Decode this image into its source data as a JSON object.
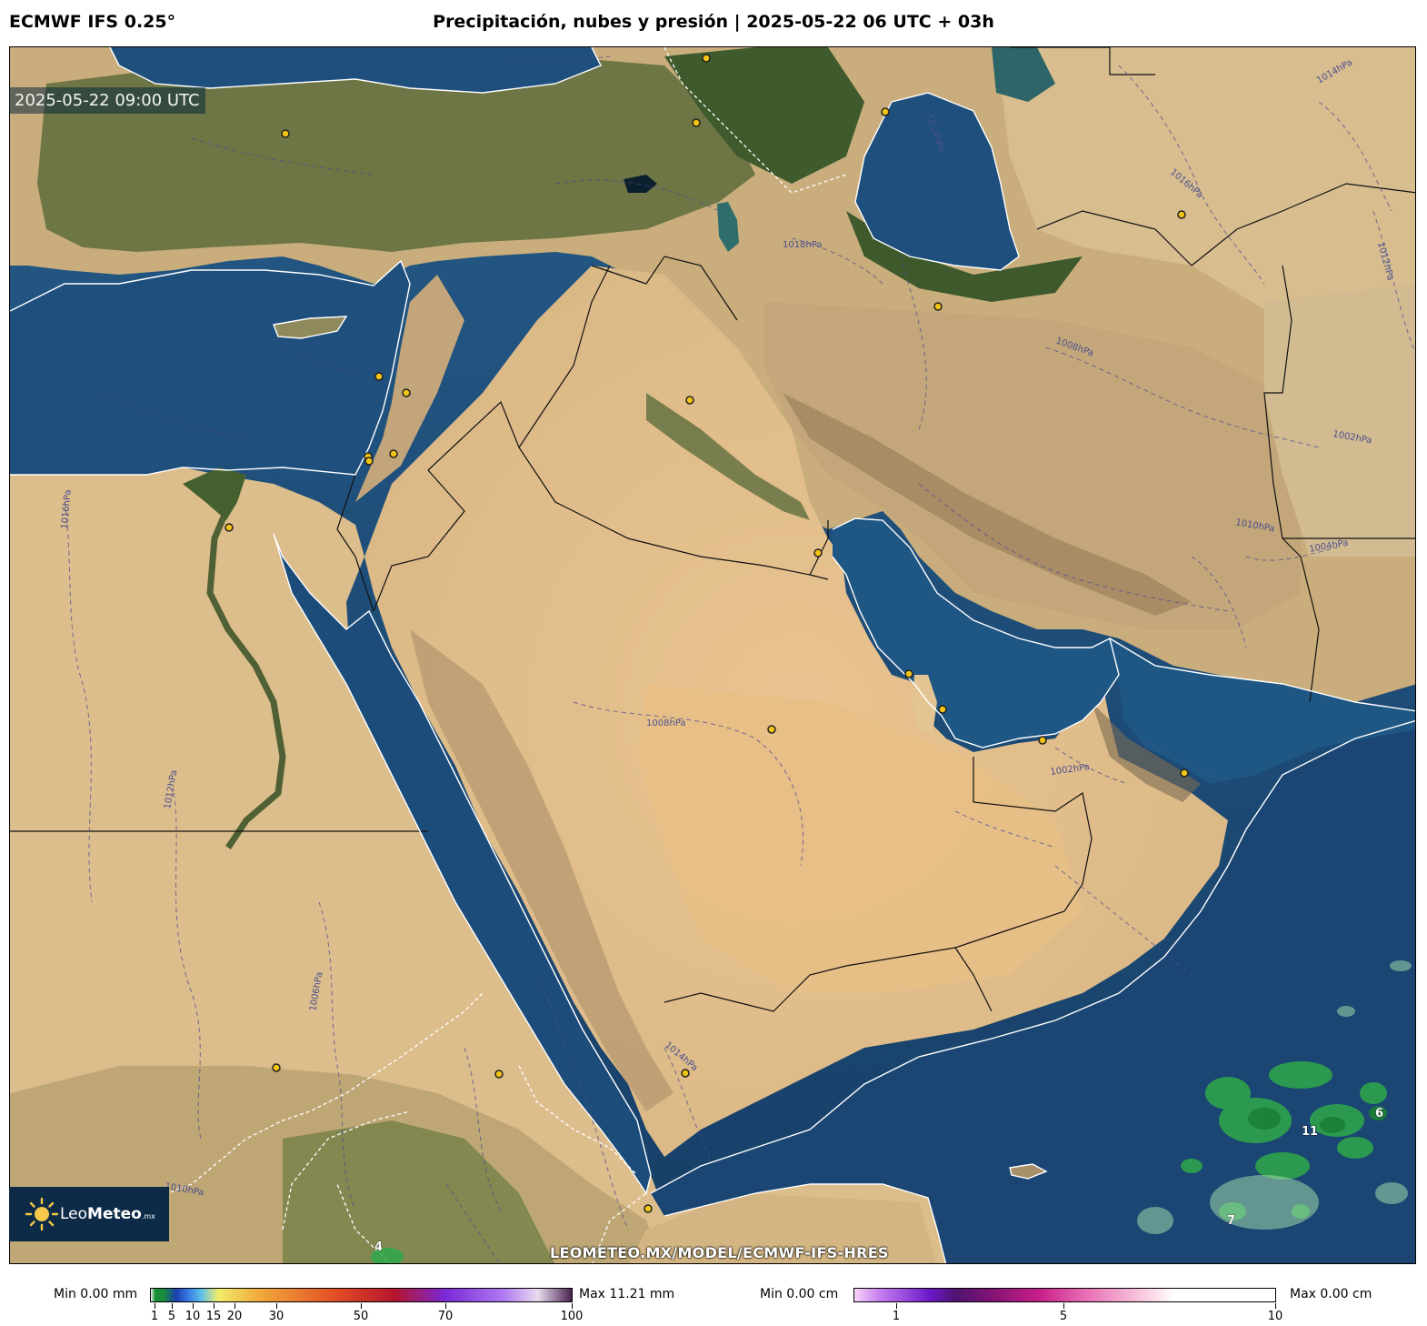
{
  "header": {
    "model": "ECMWF IFS 0.25°",
    "title": "Precipitación, nubes y presión | 2025-05-22 06 UTC + 03h"
  },
  "map": {
    "valid_time": "2025-05-22 09:00 UTC",
    "url": "LEOMETEO.MX/MODEL/ECMWF-IFS-HRES",
    "logo": {
      "brand_light": "Leo",
      "brand_bold": "Meteo",
      "suffix": ".mx"
    },
    "isobar_labels": [
      "1008hPa",
      "1012hPa",
      "1014hPa",
      "1016hPa",
      "1016hPa",
      "1018hPa",
      "1014hPa",
      "1012hPa",
      "1010hPa",
      "1008hPa",
      "1004hPa",
      "1002hPa",
      "1002hPa",
      "1006hPa",
      "1010hPa",
      "1014hPa"
    ],
    "precip_values": [
      "11",
      "6",
      "7",
      "4"
    ],
    "colors": {
      "sea": "#1d4e7a",
      "desert": "#e6c896",
      "vegetation": "#4e6b35",
      "precip": "#2ea84a"
    }
  },
  "colorbar_precip": {
    "min_label": "Min 0.00 mm",
    "max_label": "Max 11.21 mm",
    "ticks": [
      "1",
      "5",
      "10",
      "15",
      "20",
      "30",
      "50",
      "70",
      "100"
    ]
  },
  "colorbar_snow": {
    "min_label": "Min 0.00 cm",
    "max_label": "Max 0.00 cm",
    "ticks": [
      "1",
      "5",
      "10"
    ]
  }
}
